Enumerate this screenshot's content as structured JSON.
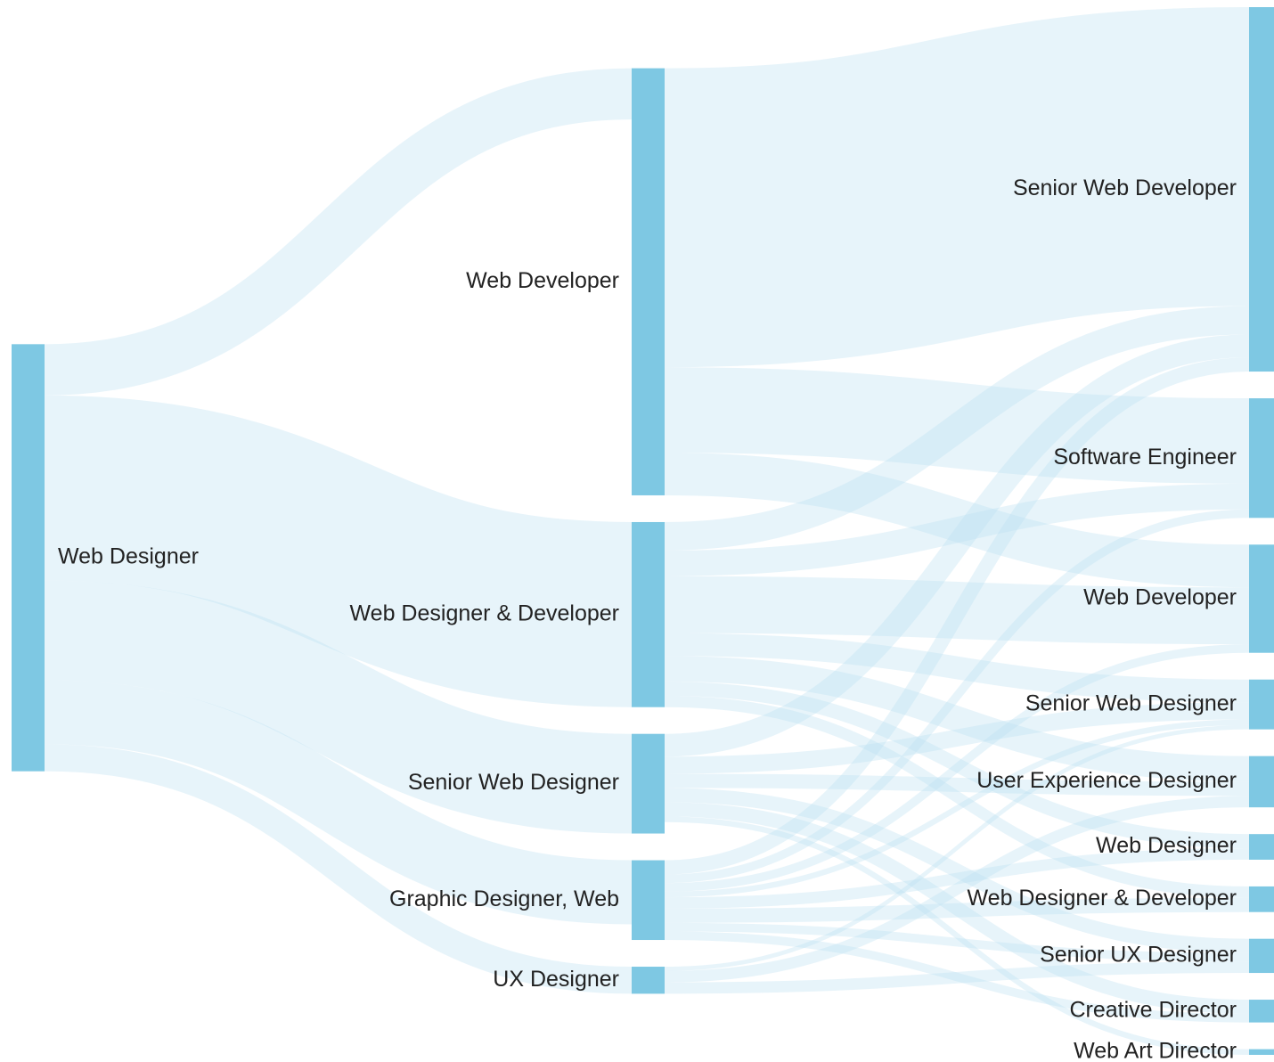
{
  "diagram": {
    "type": "sankey",
    "colors": {
      "node": "#7ec8e3",
      "link": "#b9e0f2"
    },
    "columns": [
      {
        "key": "col0",
        "nodes": [
          {
            "id": "wd0",
            "label": "Web Designer"
          }
        ]
      },
      {
        "key": "col1",
        "nodes": [
          {
            "id": "wdev1",
            "label": "Web Developer"
          },
          {
            "id": "wdd1",
            "label": "Web Designer & Developer"
          },
          {
            "id": "swd1",
            "label": "Senior Web Designer"
          },
          {
            "id": "gdw1",
            "label": "Graphic Designer, Web"
          },
          {
            "id": "ux1",
            "label": "UX Designer"
          }
        ]
      },
      {
        "key": "col2",
        "nodes": [
          {
            "id": "swdev2",
            "label": "Senior Web Developer"
          },
          {
            "id": "se2",
            "label": "Software Engineer"
          },
          {
            "id": "wdev2",
            "label": "Web Developer"
          },
          {
            "id": "swd2",
            "label": "Senior Web Designer"
          },
          {
            "id": "uxd2",
            "label": "User Experience Designer"
          },
          {
            "id": "wd2",
            "label": "Web Designer"
          },
          {
            "id": "wdd2",
            "label": "Web Designer & Developer"
          },
          {
            "id": "sux2",
            "label": "Senior UX Designer"
          },
          {
            "id": "cd2",
            "label": "Creative Director"
          },
          {
            "id": "wad2",
            "label": "Web Art Director"
          }
        ]
      }
    ],
    "links": [
      {
        "source": "wd0",
        "target": "wdev1",
        "value": 36
      },
      {
        "source": "wd0",
        "target": "wdd1",
        "value": 130
      },
      {
        "source": "wd0",
        "target": "swd1",
        "value": 70
      },
      {
        "source": "wd0",
        "target": "gdw1",
        "value": 45
      },
      {
        "source": "wd0",
        "target": "ux1",
        "value": 19
      },
      {
        "source": "wdev1",
        "target": "swdev2",
        "value": 210
      },
      {
        "source": "wdev1",
        "target": "se2",
        "value": 60
      },
      {
        "source": "wdev1",
        "target": "wdev2",
        "value": 30
      },
      {
        "source": "wdd1",
        "target": "swdev2",
        "value": 20
      },
      {
        "source": "wdd1",
        "target": "se2",
        "value": 18
      },
      {
        "source": "wdd1",
        "target": "wdev2",
        "value": 40
      },
      {
        "source": "wdd1",
        "target": "swd2",
        "value": 16
      },
      {
        "source": "wdd1",
        "target": "uxd2",
        "value": 18
      },
      {
        "source": "wdd1",
        "target": "wd2",
        "value": 10
      },
      {
        "source": "wdd1",
        "target": "wdd2",
        "value": 8
      },
      {
        "source": "swd1",
        "target": "swdev2",
        "value": 16
      },
      {
        "source": "swd1",
        "target": "uxd2",
        "value": 10
      },
      {
        "source": "swd1",
        "target": "swd2",
        "value": 12
      },
      {
        "source": "swd1",
        "target": "sux2",
        "value": 10
      },
      {
        "source": "swd1",
        "target": "cd2",
        "value": 10
      },
      {
        "source": "swd1",
        "target": "wad2",
        "value": 4
      },
      {
        "source": "gdw1",
        "target": "swdev2",
        "value": 10
      },
      {
        "source": "gdw1",
        "target": "se2",
        "value": 6
      },
      {
        "source": "gdw1",
        "target": "wdev2",
        "value": 6
      },
      {
        "source": "gdw1",
        "target": "wd2",
        "value": 8
      },
      {
        "source": "gdw1",
        "target": "wdd2",
        "value": 10
      },
      {
        "source": "gdw1",
        "target": "sux2",
        "value": 6
      },
      {
        "source": "gdw1",
        "target": "cd2",
        "value": 6
      },
      {
        "source": "gdw1",
        "target": "swd2",
        "value": 4
      },
      {
        "source": "ux1",
        "target": "uxd2",
        "value": 8
      },
      {
        "source": "ux1",
        "target": "sux2",
        "value": 8
      },
      {
        "source": "ux1",
        "target": "swd2",
        "value": 3
      }
    ]
  }
}
